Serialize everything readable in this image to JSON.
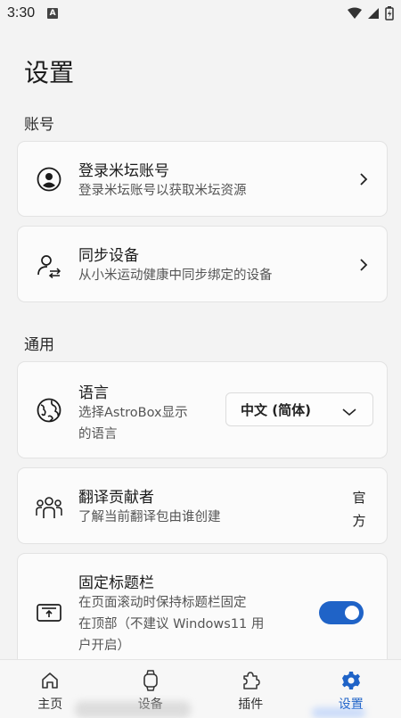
{
  "status_bar": {
    "time": "3:30",
    "notification_letter": "A"
  },
  "page_title": "设置",
  "sections": {
    "account": {
      "label": "账号"
    },
    "general": {
      "label": "通用"
    }
  },
  "account_items": [
    {
      "title": "登录米坛账号",
      "description": "登录米坛账号以获取米坛资源",
      "icon": "user-circle-icon"
    },
    {
      "title": "同步设备",
      "description": "从小米运动健康中同步绑定的设备",
      "icon": "user-sync-icon"
    }
  ],
  "language": {
    "title": "语言",
    "description_line1": "选择AstroBox显示",
    "description_line2": "的语言",
    "selected": "中文 (简体)",
    "icon": "globe-icon"
  },
  "translators": {
    "title": "翻译贡献者",
    "description": "了解当前翻译包由谁创建",
    "value_line1": "官",
    "value_line2": "方",
    "icon": "people-group-icon"
  },
  "fixed_titlebar": {
    "title": "固定标题栏",
    "description_line1": "在页面滚动时保持标题栏固定",
    "description_line2": "在顶部（不建议 Windows11 用",
    "description_line3": "户开启）",
    "toggle_on": true,
    "icon": "titlebar-icon"
  },
  "bottom_nav": [
    {
      "label": "主页",
      "icon": "home-icon",
      "active": false
    },
    {
      "label": "设备",
      "icon": "watch-icon",
      "active": false
    },
    {
      "label": "插件",
      "icon": "puzzle-icon",
      "active": false
    },
    {
      "label": "设置",
      "icon": "gear-icon",
      "active": true
    }
  ],
  "colors": {
    "accent": "#1f63c7",
    "background": "#f3f3f3",
    "card": "#fbfbfb"
  }
}
